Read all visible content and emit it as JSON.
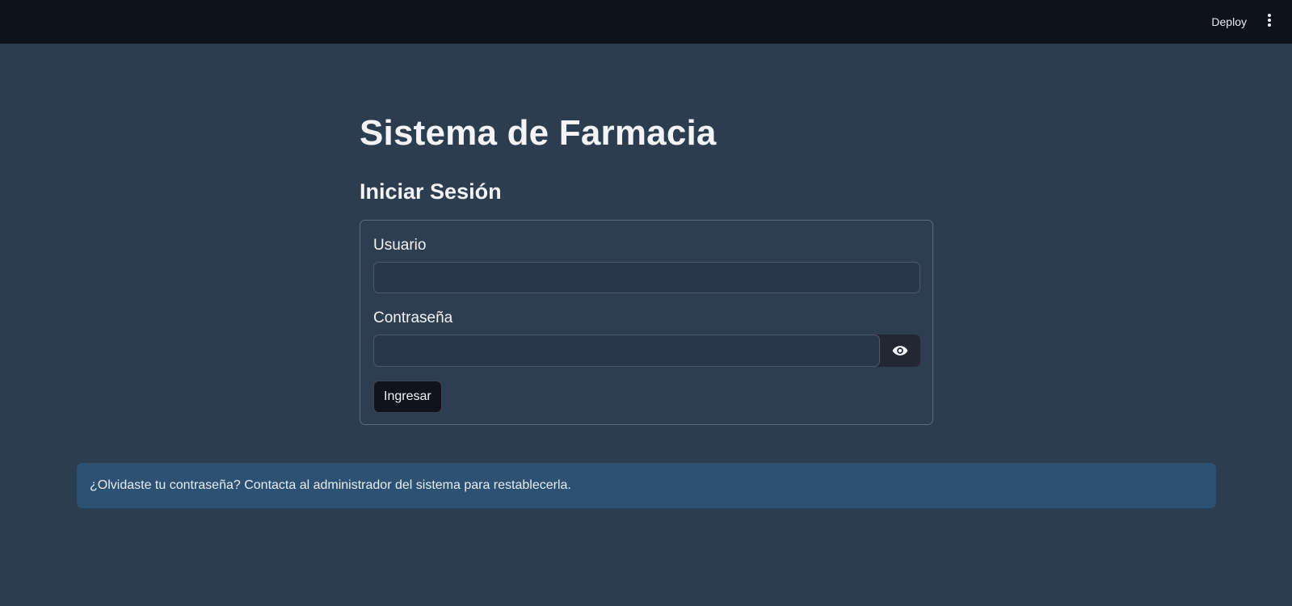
{
  "topbar": {
    "deploy_label": "Deploy",
    "menu_icon": "vertical-ellipsis-icon"
  },
  "main": {
    "title": "Sistema de Farmacia",
    "subtitle": "Iniciar Sesión"
  },
  "form": {
    "username_label": "Usuario",
    "username_value": "",
    "password_label": "Contraseña",
    "password_value": "",
    "show_password_icon": "eye-icon",
    "submit_label": "Ingresar"
  },
  "info": {
    "message": "¿Olvidaste tu contraseña? Contacta al administrador del sistema para restablecerla."
  },
  "colors": {
    "background": "#2d3d50",
    "topbar": "#0e121b",
    "info_background": "#2d5172"
  }
}
